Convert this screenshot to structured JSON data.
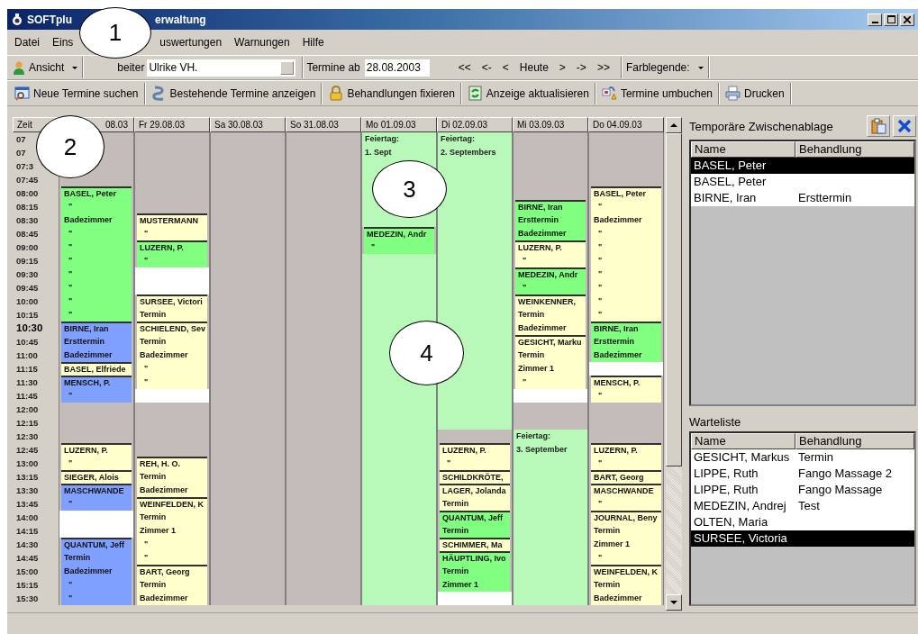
{
  "window": {
    "title_parts": [
      "SOFTplu",
      "erwaltung"
    ]
  },
  "menu": [
    "Datei",
    "Eins",
    "uswertungen",
    "Warnungen",
    "Hilfe"
  ],
  "toolbar": {
    "view_button": "Ansicht",
    "employee_label": "beiter",
    "employee_value": "Ulrike VH.",
    "date_label": "Termine ab",
    "date_value": "28.08.2003",
    "nav": [
      "<<",
      "<-",
      "<",
      "Heute",
      ">",
      "->",
      ">>"
    ],
    "legend_button": "Farblegende:"
  },
  "actions": [
    "Neue Termine suchen",
    "Bestehende Termine anzeigen",
    "Behandlungen fixieren",
    "Anzeige aktualisieren",
    "Termine umbuchen",
    "Drucken"
  ],
  "calendar": {
    "time_header": "Zeit",
    "times": [
      {
        "label": "07",
        "current": false
      },
      {
        "label": "07",
        "current": false
      },
      {
        "label": "07:3",
        "current": false
      },
      {
        "label": "07:45",
        "current": false
      },
      {
        "label": "08:00",
        "current": false
      },
      {
        "label": "08:15",
        "current": false
      },
      {
        "label": "08:30",
        "current": false
      },
      {
        "label": "08:45",
        "current": false
      },
      {
        "label": "09:00",
        "current": false
      },
      {
        "label": "09:15",
        "current": false
      },
      {
        "label": "09:30",
        "current": false
      },
      {
        "label": "09:45",
        "current": false
      },
      {
        "label": "10:00",
        "current": false
      },
      {
        "label": "10:15",
        "current": false
      },
      {
        "label": "10:30",
        "current": true
      },
      {
        "label": "10:45",
        "current": false
      },
      {
        "label": "11:00",
        "current": false
      },
      {
        "label": "11:15",
        "current": false
      },
      {
        "label": "11:30",
        "current": false
      },
      {
        "label": "11:45",
        "current": false
      },
      {
        "label": "12:00",
        "current": false
      },
      {
        "label": "12:15",
        "current": false
      },
      {
        "label": "12:30",
        "current": false
      },
      {
        "label": "12:45",
        "current": false
      },
      {
        "label": "13:00",
        "current": false
      },
      {
        "label": "13:15",
        "current": false
      },
      {
        "label": "13:30",
        "current": false
      },
      {
        "label": "13:45",
        "current": false
      },
      {
        "label": "14:00",
        "current": false
      },
      {
        "label": "14:15",
        "current": false
      },
      {
        "label": "14:30",
        "current": false
      },
      {
        "label": "14:45",
        "current": false
      },
      {
        "label": "15:00",
        "current": false
      },
      {
        "label": "15:15",
        "current": false
      },
      {
        "label": "15:30",
        "current": false
      }
    ],
    "days": [
      {
        "header": "08.03",
        "cells": [
          {
            "kind": "closed"
          },
          {
            "kind": "closed"
          },
          {
            "kind": "closed"
          },
          {
            "kind": "closed"
          },
          {
            "kind": "appointment",
            "first": true,
            "color": "#80ff80",
            "text": "BASEL, Peter"
          },
          {
            "kind": "appointment",
            "first": false,
            "text": "  \""
          },
          {
            "kind": "appointment",
            "first": false,
            "text": "Badezimmer"
          },
          {
            "kind": "appointment",
            "first": false,
            "text": "  \""
          },
          {
            "kind": "appointment",
            "first": false,
            "text": "  \""
          },
          {
            "kind": "appointment",
            "first": false,
            "text": "  \""
          },
          {
            "kind": "appointment",
            "first": false,
            "text": "  \""
          },
          {
            "kind": "appointment",
            "first": false,
            "text": "  \""
          },
          {
            "kind": "appointment",
            "first": false,
            "text": "  \""
          },
          {
            "kind": "appointment",
            "first": false,
            "text": "  \""
          },
          {
            "kind": "appointment",
            "first": true,
            "color": "#80a0ff",
            "text": "BIRNE, Iran"
          },
          {
            "kind": "appointment",
            "first": false,
            "text": "Ersttermin"
          },
          {
            "kind": "appointment",
            "first": false,
            "text": "Badezimmer"
          },
          {
            "kind": "appointment",
            "first": true,
            "color": "#ffffcc",
            "text": "BASEL, Elfriede"
          },
          {
            "kind": "appointment",
            "first": true,
            "color": "#80a0ff",
            "text": "MENSCH, P."
          },
          {
            "kind": "appointment",
            "first": false,
            "text": "  \""
          },
          {
            "kind": "closed"
          },
          {
            "kind": "closed"
          },
          {
            "kind": "closed"
          },
          {
            "kind": "appointment",
            "first": true,
            "color": "#ffffcc",
            "text": "LUZERN, P."
          },
          {
            "kind": "appointment",
            "first": false,
            "text": "  \""
          },
          {
            "kind": "appointment",
            "first": true,
            "color": "#ffffcc",
            "text": "SIEGER, Alois"
          },
          {
            "kind": "appointment",
            "first": true,
            "color": "#80a0ff",
            "text": "MASCHWANDE"
          },
          {
            "kind": "appointment",
            "first": false,
            "text": "  \""
          },
          {
            "kind": "free"
          },
          {
            "kind": "free"
          },
          {
            "kind": "appointment",
            "first": true,
            "color": "#80a0ff",
            "text": "QUANTUM, Jeff"
          },
          {
            "kind": "appointment",
            "first": false,
            "text": "Termin"
          },
          {
            "kind": "appointment",
            "first": false,
            "text": "Badezimmer"
          },
          {
            "kind": "appointment",
            "first": false,
            "text": "  \""
          },
          {
            "kind": "appointment",
            "first": false,
            "text": "  \""
          }
        ]
      },
      {
        "header": "Fr 29.08.03",
        "cells": [
          {
            "kind": "closed"
          },
          {
            "kind": "closed"
          },
          {
            "kind": "closed"
          },
          {
            "kind": "closed"
          },
          {
            "kind": "closed"
          },
          {
            "kind": "closed"
          },
          {
            "kind": "appointment",
            "first": true,
            "color": "#ffffcc",
            "text": "MUSTERMANN"
          },
          {
            "kind": "appointment",
            "first": false,
            "text": "  \""
          },
          {
            "kind": "appointment",
            "first": true,
            "color": "#80ff80",
            "text": "LUZERN, P."
          },
          {
            "kind": "appointment",
            "first": false,
            "text": "  \""
          },
          {
            "kind": "free"
          },
          {
            "kind": "free"
          },
          {
            "kind": "appointment",
            "first": true,
            "color": "#ffffcc",
            "text": "SURSEE, Victori"
          },
          {
            "kind": "appointment",
            "first": false,
            "text": "Termin"
          },
          {
            "kind": "appointment",
            "first": true,
            "color": "#ffffcc",
            "text": "SCHIELEND, Sev"
          },
          {
            "kind": "appointment",
            "first": false,
            "text": "Termin"
          },
          {
            "kind": "appointment",
            "first": false,
            "text": "Badezimmer"
          },
          {
            "kind": "appointment",
            "first": false,
            "text": "  \""
          },
          {
            "kind": "appointment",
            "first": false,
            "text": "  \""
          },
          {
            "kind": "free"
          },
          {
            "kind": "closed"
          },
          {
            "kind": "closed"
          },
          {
            "kind": "closed"
          },
          {
            "kind": "closed"
          },
          {
            "kind": "appointment",
            "first": true,
            "color": "#ffffcc",
            "text": "REH, H. O."
          },
          {
            "kind": "appointment",
            "first": false,
            "text": "Termin"
          },
          {
            "kind": "appointment",
            "first": false,
            "text": "Badezimmer"
          },
          {
            "kind": "appointment",
            "first": true,
            "color": "#ffffcc",
            "text": "WEINFELDEN, K"
          },
          {
            "kind": "appointment",
            "first": false,
            "text": "Termin"
          },
          {
            "kind": "appointment",
            "first": false,
            "text": "Zimmer 1"
          },
          {
            "kind": "appointment",
            "first": false,
            "text": "  \""
          },
          {
            "kind": "appointment",
            "first": false,
            "text": "  \""
          },
          {
            "kind": "appointment",
            "first": true,
            "color": "#ffffcc",
            "text": "BART, Georg"
          },
          {
            "kind": "appointment",
            "first": false,
            "text": "Termin"
          },
          {
            "kind": "appointment",
            "first": false,
            "text": "Badezimmer"
          }
        ]
      },
      {
        "header": "Sa 30.08.03",
        "cells": [
          {
            "kind": "closed"
          },
          {
            "kind": "closed"
          },
          {
            "kind": "closed"
          },
          {
            "kind": "closed"
          },
          {
            "kind": "closed"
          },
          {
            "kind": "closed"
          },
          {
            "kind": "closed"
          },
          {
            "kind": "closed"
          },
          {
            "kind": "closed"
          },
          {
            "kind": "closed"
          },
          {
            "kind": "closed"
          },
          {
            "kind": "closed"
          },
          {
            "kind": "closed"
          },
          {
            "kind": "closed"
          },
          {
            "kind": "closed"
          },
          {
            "kind": "closed"
          },
          {
            "kind": "closed"
          },
          {
            "kind": "closed"
          },
          {
            "kind": "closed"
          },
          {
            "kind": "closed"
          },
          {
            "kind": "closed"
          },
          {
            "kind": "closed"
          },
          {
            "kind": "closed"
          },
          {
            "kind": "closed"
          },
          {
            "kind": "closed"
          },
          {
            "kind": "closed"
          },
          {
            "kind": "closed"
          },
          {
            "kind": "closed"
          },
          {
            "kind": "closed"
          },
          {
            "kind": "closed"
          },
          {
            "kind": "closed"
          },
          {
            "kind": "closed"
          },
          {
            "kind": "closed"
          },
          {
            "kind": "closed"
          },
          {
            "kind": "closed"
          }
        ]
      },
      {
        "header": "So 31.08.03",
        "cells": [
          {
            "kind": "closed"
          },
          {
            "kind": "closed"
          },
          {
            "kind": "closed"
          },
          {
            "kind": "closed"
          },
          {
            "kind": "closed"
          },
          {
            "kind": "closed"
          },
          {
            "kind": "closed"
          },
          {
            "kind": "closed"
          },
          {
            "kind": "closed"
          },
          {
            "kind": "closed"
          },
          {
            "kind": "closed"
          },
          {
            "kind": "closed"
          },
          {
            "kind": "closed"
          },
          {
            "kind": "closed"
          },
          {
            "kind": "closed"
          },
          {
            "kind": "closed"
          },
          {
            "kind": "closed"
          },
          {
            "kind": "closed"
          },
          {
            "kind": "closed"
          },
          {
            "kind": "closed"
          },
          {
            "kind": "closed"
          },
          {
            "kind": "closed"
          },
          {
            "kind": "closed"
          },
          {
            "kind": "closed"
          },
          {
            "kind": "closed"
          },
          {
            "kind": "closed"
          },
          {
            "kind": "closed"
          },
          {
            "kind": "closed"
          },
          {
            "kind": "closed"
          },
          {
            "kind": "closed"
          },
          {
            "kind": "closed"
          },
          {
            "kind": "closed"
          },
          {
            "kind": "closed"
          },
          {
            "kind": "closed"
          },
          {
            "kind": "closed"
          }
        ]
      },
      {
        "header": "Mo 01.09.03",
        "cells": [
          {
            "kind": "holiday",
            "text": "Feiertag:"
          },
          {
            "kind": "holiday",
            "text": "1. Sept"
          },
          {
            "kind": "holiday"
          },
          {
            "kind": "holiday"
          },
          {
            "kind": "holiday"
          },
          {
            "kind": "holiday"
          },
          {
            "kind": "holiday"
          },
          {
            "kind": "appointment",
            "first": true,
            "color": "#80ff80",
            "text": "MEDEZIN, Andr"
          },
          {
            "kind": "appointment",
            "first": false,
            "text": "  \""
          },
          {
            "kind": "holiday"
          },
          {
            "kind": "holiday"
          },
          {
            "kind": "holiday"
          },
          {
            "kind": "holiday"
          },
          {
            "kind": "holiday"
          },
          {
            "kind": "holiday"
          },
          {
            "kind": "holiday"
          },
          {
            "kind": "holiday"
          },
          {
            "kind": "holiday"
          },
          {
            "kind": "holiday"
          },
          {
            "kind": "holiday"
          },
          {
            "kind": "holiday"
          },
          {
            "kind": "holiday"
          },
          {
            "kind": "holiday"
          },
          {
            "kind": "holiday"
          },
          {
            "kind": "holiday"
          },
          {
            "kind": "holiday"
          },
          {
            "kind": "holiday"
          },
          {
            "kind": "holiday"
          },
          {
            "kind": "holiday"
          },
          {
            "kind": "holiday"
          },
          {
            "kind": "holiday"
          },
          {
            "kind": "holiday"
          },
          {
            "kind": "holiday"
          },
          {
            "kind": "holiday"
          },
          {
            "kind": "holiday"
          }
        ]
      },
      {
        "header": "Di 02.09.03",
        "cells": [
          {
            "kind": "holiday",
            "text": "Feiertag:"
          },
          {
            "kind": "holiday",
            "text": "2. Septembers"
          },
          {
            "kind": "holiday"
          },
          {
            "kind": "holiday"
          },
          {
            "kind": "holiday"
          },
          {
            "kind": "holiday"
          },
          {
            "kind": "holiday"
          },
          {
            "kind": "holiday"
          },
          {
            "kind": "holiday"
          },
          {
            "kind": "holiday"
          },
          {
            "kind": "holiday"
          },
          {
            "kind": "holiday"
          },
          {
            "kind": "holiday"
          },
          {
            "kind": "holiday"
          },
          {
            "kind": "holiday"
          },
          {
            "kind": "holiday"
          },
          {
            "kind": "holiday"
          },
          {
            "kind": "holiday"
          },
          {
            "kind": "holiday"
          },
          {
            "kind": "holiday"
          },
          {
            "kind": "holiday"
          },
          {
            "kind": "holiday"
          },
          {
            "kind": "closed"
          },
          {
            "kind": "appointment",
            "first": true,
            "color": "#ffffcc",
            "text": "LUZERN, P."
          },
          {
            "kind": "appointment",
            "first": false,
            "text": "  \""
          },
          {
            "kind": "appointment",
            "first": true,
            "color": "#ffffcc",
            "text": "SCHILDKRÖTE,"
          },
          {
            "kind": "appointment",
            "first": true,
            "color": "#ffffcc",
            "text": "LAGER, Jolanda"
          },
          {
            "kind": "appointment",
            "first": false,
            "text": "Termin"
          },
          {
            "kind": "appointment",
            "first": true,
            "color": "#80ff80",
            "text": "QUANTUM, Jeff"
          },
          {
            "kind": "appointment",
            "first": false,
            "text": "Termin"
          },
          {
            "kind": "appointment",
            "first": true,
            "color": "#ffffcc",
            "text": "SCHIMMER, Ma"
          },
          {
            "kind": "appointment",
            "first": true,
            "color": "#80ff80",
            "text": "HÄUPTLING, Ivo"
          },
          {
            "kind": "appointment",
            "first": false,
            "text": "Termin"
          },
          {
            "kind": "appointment",
            "first": false,
            "text": "Zimmer 1"
          },
          {
            "kind": "free"
          }
        ]
      },
      {
        "header": "Mi 03.09.03",
        "cells": [
          {
            "kind": "closed"
          },
          {
            "kind": "closed"
          },
          {
            "kind": "closed"
          },
          {
            "kind": "closed"
          },
          {
            "kind": "closed"
          },
          {
            "kind": "appointment",
            "first": true,
            "color": "#80ff80",
            "text": "BIRNE, Iran"
          },
          {
            "kind": "appointment",
            "first": false,
            "text": "Ersttermin"
          },
          {
            "kind": "appointment",
            "first": false,
            "text": "Badezimmer"
          },
          {
            "kind": "appointment",
            "first": true,
            "color": "#ffffcc",
            "text": "LUZERN, P."
          },
          {
            "kind": "appointment",
            "first": false,
            "text": "  \""
          },
          {
            "kind": "appointment",
            "first": true,
            "color": "#80ff80",
            "text": "MEDEZIN, Andr"
          },
          {
            "kind": "appointment",
            "first": false,
            "text": "  \""
          },
          {
            "kind": "appointment",
            "first": true,
            "color": "#ffffcc",
            "text": "WEINKENNER,"
          },
          {
            "kind": "appointment",
            "first": false,
            "text": "Termin"
          },
          {
            "kind": "appointment",
            "first": false,
            "text": "Badezimmer"
          },
          {
            "kind": "appointment",
            "first": true,
            "color": "#ffffcc",
            "text": "GESICHT, Marku"
          },
          {
            "kind": "appointment",
            "first": false,
            "text": "Termin"
          },
          {
            "kind": "appointment",
            "first": false,
            "text": "Zimmer 1"
          },
          {
            "kind": "appointment",
            "first": false,
            "text": "  \""
          },
          {
            "kind": "free"
          },
          {
            "kind": "closed"
          },
          {
            "kind": "closed"
          },
          {
            "kind": "holiday",
            "text": "Feiertag:"
          },
          {
            "kind": "holiday",
            "text": "3. September"
          },
          {
            "kind": "holiday"
          },
          {
            "kind": "holiday"
          },
          {
            "kind": "holiday"
          },
          {
            "kind": "holiday"
          },
          {
            "kind": "holiday"
          },
          {
            "kind": "holiday"
          },
          {
            "kind": "holiday"
          },
          {
            "kind": "holiday"
          },
          {
            "kind": "holiday"
          },
          {
            "kind": "holiday"
          },
          {
            "kind": "holiday"
          }
        ]
      },
      {
        "header": "Do 04.09.03",
        "cells": [
          {
            "kind": "closed"
          },
          {
            "kind": "closed"
          },
          {
            "kind": "closed"
          },
          {
            "kind": "closed"
          },
          {
            "kind": "appointment",
            "first": true,
            "color": "#ffffcc",
            "text": "BASEL, Peter"
          },
          {
            "kind": "appointment",
            "first": false,
            "text": "  \""
          },
          {
            "kind": "appointment",
            "first": false,
            "text": "Badezimmer"
          },
          {
            "kind": "appointment",
            "first": false,
            "text": "  \""
          },
          {
            "kind": "appointment",
            "first": false,
            "text": "  \""
          },
          {
            "kind": "appointment",
            "first": false,
            "text": "  \""
          },
          {
            "kind": "appointment",
            "first": false,
            "text": "  \""
          },
          {
            "kind": "appointment",
            "first": false,
            "text": "  \""
          },
          {
            "kind": "appointment",
            "first": false,
            "text": "  \""
          },
          {
            "kind": "appointment",
            "first": false,
            "text": "  \""
          },
          {
            "kind": "appointment",
            "first": true,
            "color": "#80ff80",
            "text": "BIRNE, Iran"
          },
          {
            "kind": "appointment",
            "first": false,
            "text": "Ersttermin"
          },
          {
            "kind": "appointment",
            "first": false,
            "text": "Badezimmer"
          },
          {
            "kind": "free"
          },
          {
            "kind": "appointment",
            "first": true,
            "color": "#ffffcc",
            "text": "MENSCH, P."
          },
          {
            "kind": "appointment",
            "first": false,
            "text": "  \""
          },
          {
            "kind": "closed"
          },
          {
            "kind": "closed"
          },
          {
            "kind": "closed"
          },
          {
            "kind": "appointment",
            "first": true,
            "color": "#ffffcc",
            "text": "LUZERN, P."
          },
          {
            "kind": "appointment",
            "first": false,
            "text": "  \""
          },
          {
            "kind": "appointment",
            "first": true,
            "color": "#ffffcc",
            "text": "BART, Georg"
          },
          {
            "kind": "appointment",
            "first": true,
            "color": "#ffffcc",
            "text": "MASCHWANDE"
          },
          {
            "kind": "appointment",
            "first": false,
            "text": "  \""
          },
          {
            "kind": "appointment",
            "first": true,
            "color": "#ffffcc",
            "text": "JOURNAL, Beny"
          },
          {
            "kind": "appointment",
            "first": false,
            "text": "Termin"
          },
          {
            "kind": "appointment",
            "first": false,
            "text": "Zimmer 1"
          },
          {
            "kind": "appointment",
            "first": false,
            "text": "  \""
          },
          {
            "kind": "appointment",
            "first": true,
            "color": "#ffffcc",
            "text": "WEINFELDEN, K"
          },
          {
            "kind": "appointment",
            "first": false,
            "text": "Termin"
          },
          {
            "kind": "appointment",
            "first": false,
            "text": "Badezimmer"
          }
        ]
      }
    ]
  },
  "clipboard": {
    "title": "Temporäre Zwischenablage",
    "columns": [
      "Name",
      "Behandlung"
    ],
    "rows": [
      {
        "name": "BASEL, Peter",
        "selected": true
      },
      {
        "name": "BASEL, Peter",
        "selected": false
      },
      {
        "name": "BIRNE, Iran",
        "treatment": "Ersttermin",
        "selected": false
      }
    ]
  },
  "waiting_list": {
    "title": "Warteliste",
    "columns": [
      "Name",
      "Behandlung"
    ],
    "rows": [
      {
        "name": "GESICHT, Markus",
        "treatment": "Termin",
        "selected": false
      },
      {
        "name": "LIPPE, Ruth",
        "treatment": "Fango Massage 2",
        "selected": false
      },
      {
        "name": "LIPPE, Ruth",
        "treatment": "Fango Massage",
        "selected": false
      },
      {
        "name": "MEDEZIN, Andrej",
        "treatment": "Test",
        "selected": false
      },
      {
        "name": "OLTEN, Maria",
        "selected": false
      },
      {
        "name": "SURSEE, Victoria",
        "selected": true
      }
    ]
  },
  "callouts": [
    "1",
    "2",
    "3",
    "4"
  ]
}
